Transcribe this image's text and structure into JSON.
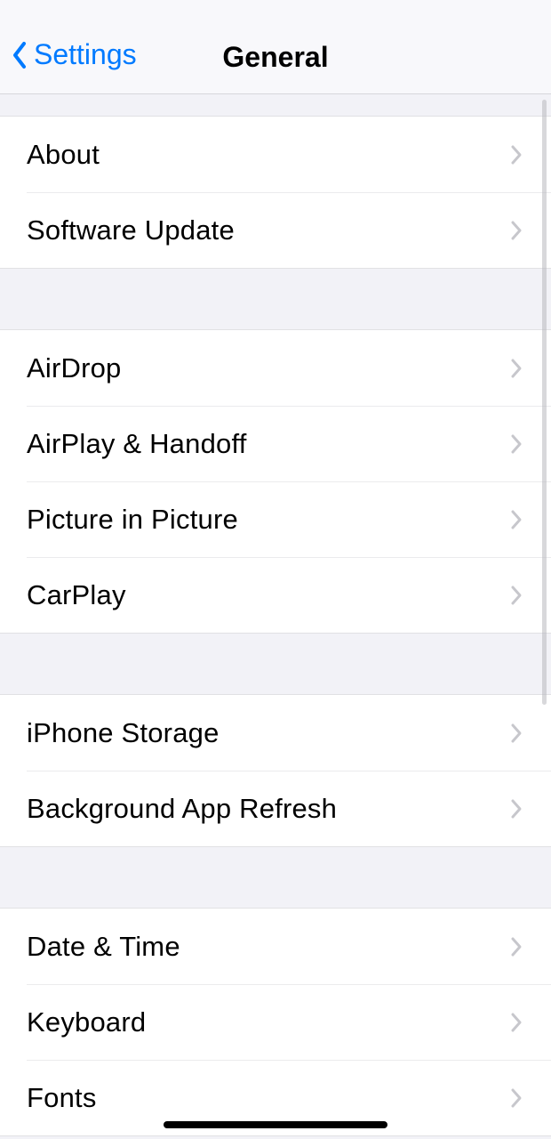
{
  "nav": {
    "back_label": "Settings",
    "title": "General"
  },
  "sections": [
    {
      "rows": [
        {
          "id": "about",
          "label": "About"
        },
        {
          "id": "software-update",
          "label": "Software Update"
        }
      ]
    },
    {
      "rows": [
        {
          "id": "airdrop",
          "label": "AirDrop"
        },
        {
          "id": "airplay-handoff",
          "label": "AirPlay & Handoff"
        },
        {
          "id": "picture-in-picture",
          "label": "Picture in Picture"
        },
        {
          "id": "carplay",
          "label": "CarPlay"
        }
      ]
    },
    {
      "rows": [
        {
          "id": "iphone-storage",
          "label": "iPhone Storage"
        },
        {
          "id": "background-app-refresh",
          "label": "Background App Refresh"
        }
      ]
    },
    {
      "rows": [
        {
          "id": "date-time",
          "label": "Date & Time"
        },
        {
          "id": "keyboard",
          "label": "Keyboard"
        },
        {
          "id": "fonts",
          "label": "Fonts"
        }
      ]
    }
  ]
}
